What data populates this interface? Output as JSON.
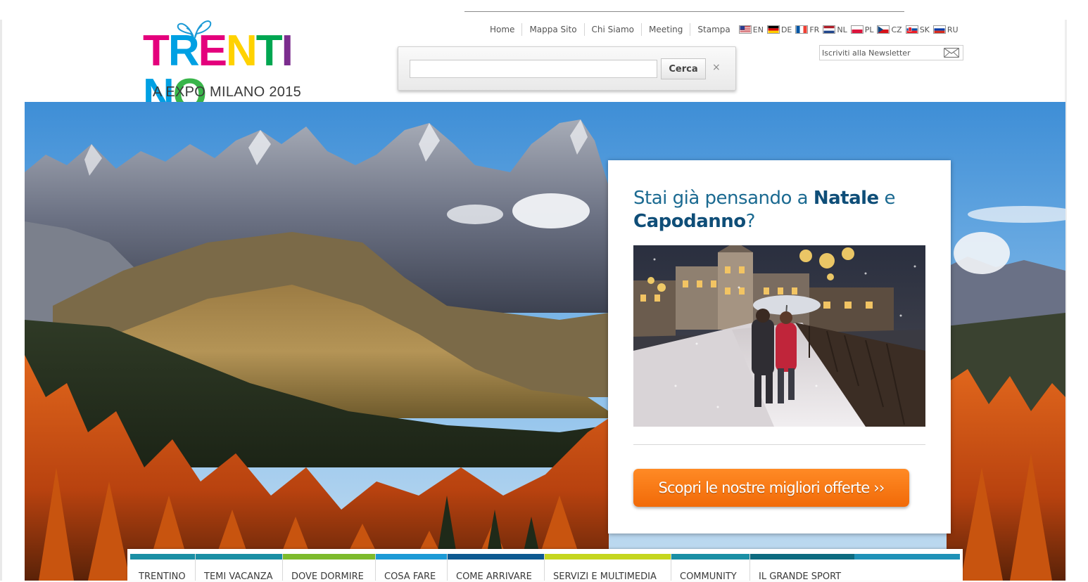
{
  "logo": {
    "wordmark": [
      "T",
      "R",
      "E",
      "N",
      "T",
      "I",
      "N",
      "O"
    ],
    "colors": [
      "#e4007c",
      "#00a0e3",
      "#e4007c",
      "#ffd200",
      "#00a651",
      "#7b2d8e",
      "#00a0e3",
      "#39b54a"
    ],
    "subtitle": "A EXPO MILANO 2015"
  },
  "top_nav": {
    "links": [
      "Home",
      "Mappa Sito",
      "Chi Siamo",
      "Meeting",
      "Stampa"
    ],
    "languages": [
      "EN",
      "DE",
      "FR",
      "NL",
      "PL",
      "CZ",
      "SK",
      "RU"
    ]
  },
  "search": {
    "value": "",
    "button_label": "Cerca",
    "clear_label": "×"
  },
  "newsletter": {
    "placeholder": "Iscriviti alla Newsletter"
  },
  "promo": {
    "title_part1": "Stai già pensando a ",
    "title_strong1": "Natale",
    "title_part2": " e ",
    "title_strong2": "Capodanno",
    "title_part3": "?",
    "cta_label": "Scopri le nostre migliori offerte ››"
  },
  "main_menu": {
    "items": [
      {
        "label": "TRENTINO",
        "color": "#1a8fa5"
      },
      {
        "label": "TEMI VACANZA",
        "color": "#1a8fa5"
      },
      {
        "label": "DOVE DORMIRE",
        "color": "#7dbb2c"
      },
      {
        "label": "COSA FARE",
        "color": "#1c9ad6"
      },
      {
        "label": "COME ARRIVARE",
        "color": "#0d5a91"
      },
      {
        "label": "SERVIZI E MULTIMEDIA",
        "color": "#c5d61e"
      },
      {
        "label": "COMMUNITY",
        "color": "#1a8fa5"
      },
      {
        "label": "IL GRANDE SPORT",
        "color": "#0d6b80"
      }
    ],
    "tail_color": "#1f92b8"
  }
}
